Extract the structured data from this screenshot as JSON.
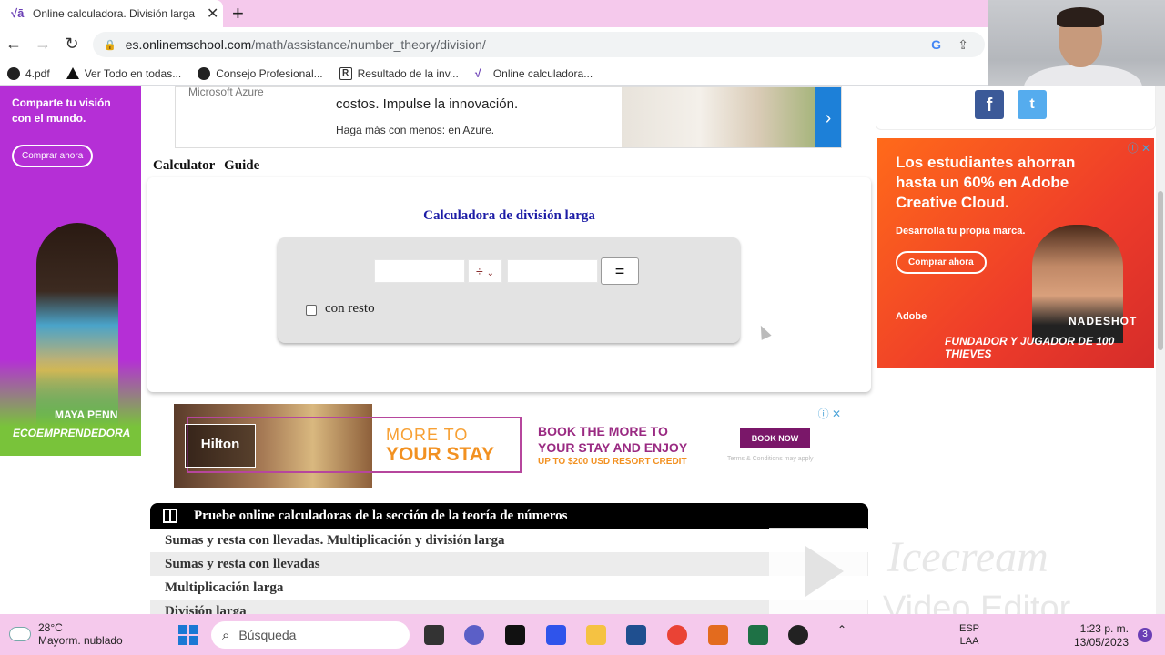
{
  "browser": {
    "tab_title": "Online calculadora. División larga",
    "new_tab_icon": "plus-icon",
    "url_host": "es.onlinemschool.com",
    "url_path": "/math/assistance/number_theory/division/",
    "bookmarks": [
      {
        "label": "4.pdf",
        "icon": "globe-icon"
      },
      {
        "label": "Ver Todo en todas...",
        "icon": "triangle-icon"
      },
      {
        "label": "Consejo Profesional...",
        "icon": "globe-icon"
      },
      {
        "label": "Resultado de la inv...",
        "icon": "r-logo-icon"
      },
      {
        "label": "Online calculadora...",
        "icon": "vf-logo-icon"
      }
    ]
  },
  "ads": {
    "left": {
      "text": "Comparte tu visión con el mundo.",
      "button": "Comprar ahora",
      "name": "MAYA PENN",
      "tag": "ECOEMPRENDEDORA"
    },
    "top": {
      "logo": "Microsoft Azure",
      "headline1": "costos. Impulse la innovación.",
      "headline2": "Haga más con menos: en Azure."
    },
    "hilton": {
      "logo": "Hilton",
      "more1": "MORE TO",
      "more2": "YOUR STAY",
      "book1": "BOOK THE MORE TO",
      "book2": "YOUR STAY AND ENJOY",
      "book3": "UP TO $200 USD RESORT CREDIT",
      "button": "BOOK NOW",
      "terms": "Terms & Conditions may apply"
    },
    "right": {
      "headline": "Los estudiantes ahorran hasta un 60% en Adobe Creative Cloud.",
      "sub": "Desarrolla tu propia marca.",
      "button": "Comprar ahora",
      "brand": "Adobe",
      "name": "NADESHOT",
      "caption": "FUNDADOR Y JUGADOR DE 100 THIEVES"
    }
  },
  "calculator": {
    "tabs": [
      "Calculator",
      "Guide"
    ],
    "title": "Calculadora de división larga",
    "operator": "÷",
    "equals": "=",
    "remainder_label": "con resto",
    "dividend": "",
    "divisor": ""
  },
  "topics": {
    "header": "Pruebe online calculadoras de la sección de la teoría de números",
    "items": [
      "Sumas y resta con llevadas. Multiplicación y división larga",
      "Sumas y resta con llevadas",
      "Multiplicación larga",
      "División larga"
    ]
  },
  "watermark": {
    "line1": "Icecream",
    "line2": "Video Editor"
  },
  "taskbar": {
    "temp": "28°C",
    "weather": "Mayorm. nublado",
    "search_placeholder": "Búsqueda",
    "lang1": "ESP",
    "lang2": "LAA",
    "time": "1:23 p. m.",
    "date": "13/05/2023",
    "notifications": "3"
  },
  "colors": {
    "tabbar": "#f5c9ec",
    "calc_title": "#1c1ca6",
    "left_ad": "#b52fd6",
    "right_ad": "#ff6a1a"
  }
}
